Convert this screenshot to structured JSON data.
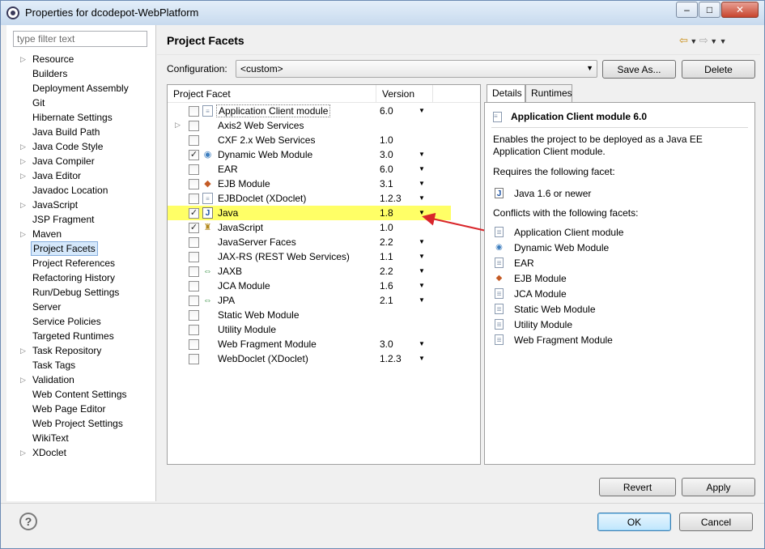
{
  "window": {
    "title": "Properties for dcodepot-WebPlatform",
    "minimize_label": "–",
    "maximize_label": "□",
    "close_label": "✕"
  },
  "sidebar": {
    "filter_placeholder": "type filter text",
    "items": [
      {
        "label": "Resource",
        "expandable": true
      },
      {
        "label": "Builders",
        "expandable": false
      },
      {
        "label": "Deployment Assembly",
        "expandable": false
      },
      {
        "label": "Git",
        "expandable": false
      },
      {
        "label": "Hibernate Settings",
        "expandable": false
      },
      {
        "label": "Java Build Path",
        "expandable": false
      },
      {
        "label": "Java Code Style",
        "expandable": true
      },
      {
        "label": "Java Compiler",
        "expandable": true
      },
      {
        "label": "Java Editor",
        "expandable": true
      },
      {
        "label": "Javadoc Location",
        "expandable": false
      },
      {
        "label": "JavaScript",
        "expandable": true
      },
      {
        "label": "JSP Fragment",
        "expandable": false
      },
      {
        "label": "Maven",
        "expandable": true
      },
      {
        "label": "Project Facets",
        "expandable": false,
        "selected": true
      },
      {
        "label": "Project References",
        "expandable": false
      },
      {
        "label": "Refactoring History",
        "expandable": false
      },
      {
        "label": "Run/Debug Settings",
        "expandable": false
      },
      {
        "label": "Server",
        "expandable": false
      },
      {
        "label": "Service Policies",
        "expandable": false
      },
      {
        "label": "Targeted Runtimes",
        "expandable": false
      },
      {
        "label": "Task Repository",
        "expandable": true
      },
      {
        "label": "Task Tags",
        "expandable": false
      },
      {
        "label": "Validation",
        "expandable": true
      },
      {
        "label": "Web Content Settings",
        "expandable": false
      },
      {
        "label": "Web Page Editor",
        "expandable": false
      },
      {
        "label": "Web Project Settings",
        "expandable": false
      },
      {
        "label": "WikiText",
        "expandable": false
      },
      {
        "label": "XDoclet",
        "expandable": true
      }
    ]
  },
  "header": {
    "title": "Project Facets"
  },
  "config": {
    "label": "Configuration:",
    "value": "<custom>",
    "save_as_label": "Save As...",
    "delete_label": "Delete"
  },
  "facets": {
    "col_facet": "Project Facet",
    "col_version": "Version",
    "rows": [
      {
        "name": "Application Client module",
        "version": "6.0",
        "checked": false,
        "icon": "doc",
        "caret": true,
        "expandable": false
      },
      {
        "name": "Axis2 Web Services",
        "version": "",
        "checked": false,
        "icon": "blank",
        "caret": false,
        "expandable": true
      },
      {
        "name": "CXF 2.x Web Services",
        "version": "1.0",
        "checked": false,
        "icon": "blank",
        "caret": false,
        "expandable": false
      },
      {
        "name": "Dynamic Web Module",
        "version": "3.0",
        "checked": true,
        "icon": "globe",
        "caret": true,
        "expandable": false
      },
      {
        "name": "EAR",
        "version": "6.0",
        "checked": false,
        "icon": "blank",
        "caret": true,
        "expandable": false
      },
      {
        "name": "EJB Module",
        "version": "3.1",
        "checked": false,
        "icon": "ejb",
        "caret": true,
        "expandable": false
      },
      {
        "name": "EJBDoclet (XDoclet)",
        "version": "1.2.3",
        "checked": false,
        "icon": "doc",
        "caret": true,
        "expandable": false
      },
      {
        "name": "Java",
        "version": "1.8",
        "checked": true,
        "icon": "java",
        "caret": true,
        "expandable": false,
        "highlight": true
      },
      {
        "name": "JavaScript",
        "version": "1.0",
        "checked": true,
        "icon": "js",
        "caret": false,
        "expandable": false
      },
      {
        "name": "JavaServer Faces",
        "version": "2.2",
        "checked": false,
        "icon": "blank",
        "caret": true,
        "expandable": false
      },
      {
        "name": "JAX-RS (REST Web Services)",
        "version": "1.1",
        "checked": false,
        "icon": "blank",
        "caret": true,
        "expandable": false
      },
      {
        "name": "JAXB",
        "version": "2.2",
        "checked": false,
        "icon": "xml",
        "caret": true,
        "expandable": false
      },
      {
        "name": "JCA Module",
        "version": "1.6",
        "checked": false,
        "icon": "blank",
        "caret": true,
        "expandable": false
      },
      {
        "name": "JPA",
        "version": "2.1",
        "checked": false,
        "icon": "xml",
        "caret": true,
        "expandable": false
      },
      {
        "name": "Static Web Module",
        "version": "",
        "checked": false,
        "icon": "blank",
        "caret": false,
        "expandable": false
      },
      {
        "name": "Utility Module",
        "version": "",
        "checked": false,
        "icon": "blank",
        "caret": false,
        "expandable": false
      },
      {
        "name": "Web Fragment Module",
        "version": "3.0",
        "checked": false,
        "icon": "blank",
        "caret": true,
        "expandable": false
      },
      {
        "name": "WebDoclet (XDoclet)",
        "version": "1.2.3",
        "checked": false,
        "icon": "blank",
        "caret": true,
        "expandable": false
      }
    ]
  },
  "details": {
    "tab_details": "Details",
    "tab_runtimes": "Runtimes",
    "title": "Application Client module 6.0",
    "description": "Enables the project to be deployed as a Java EE Application Client module.",
    "requires_label": "Requires the following facet:",
    "requires_item": "Java 1.6 or newer",
    "conflicts_label": "Conflicts with the following facets:",
    "conflicts": [
      {
        "label": "Application Client module",
        "icon": "doc"
      },
      {
        "label": "Dynamic Web Module",
        "icon": "globe"
      },
      {
        "label": "EAR",
        "icon": "doc"
      },
      {
        "label": "EJB Module",
        "icon": "ejb"
      },
      {
        "label": "JCA Module",
        "icon": "doc"
      },
      {
        "label": "Static Web Module",
        "icon": "doc"
      },
      {
        "label": "Utility Module",
        "icon": "doc"
      },
      {
        "label": "Web Fragment Module",
        "icon": "doc"
      }
    ]
  },
  "actions": {
    "revert_label": "Revert",
    "apply_label": "Apply",
    "ok_label": "OK",
    "cancel_label": "Cancel",
    "help_label": "?"
  },
  "colors": {
    "highlight": "#ffff66",
    "annotation_arrow": "#d9262b",
    "selection": "#d5e8fb"
  }
}
